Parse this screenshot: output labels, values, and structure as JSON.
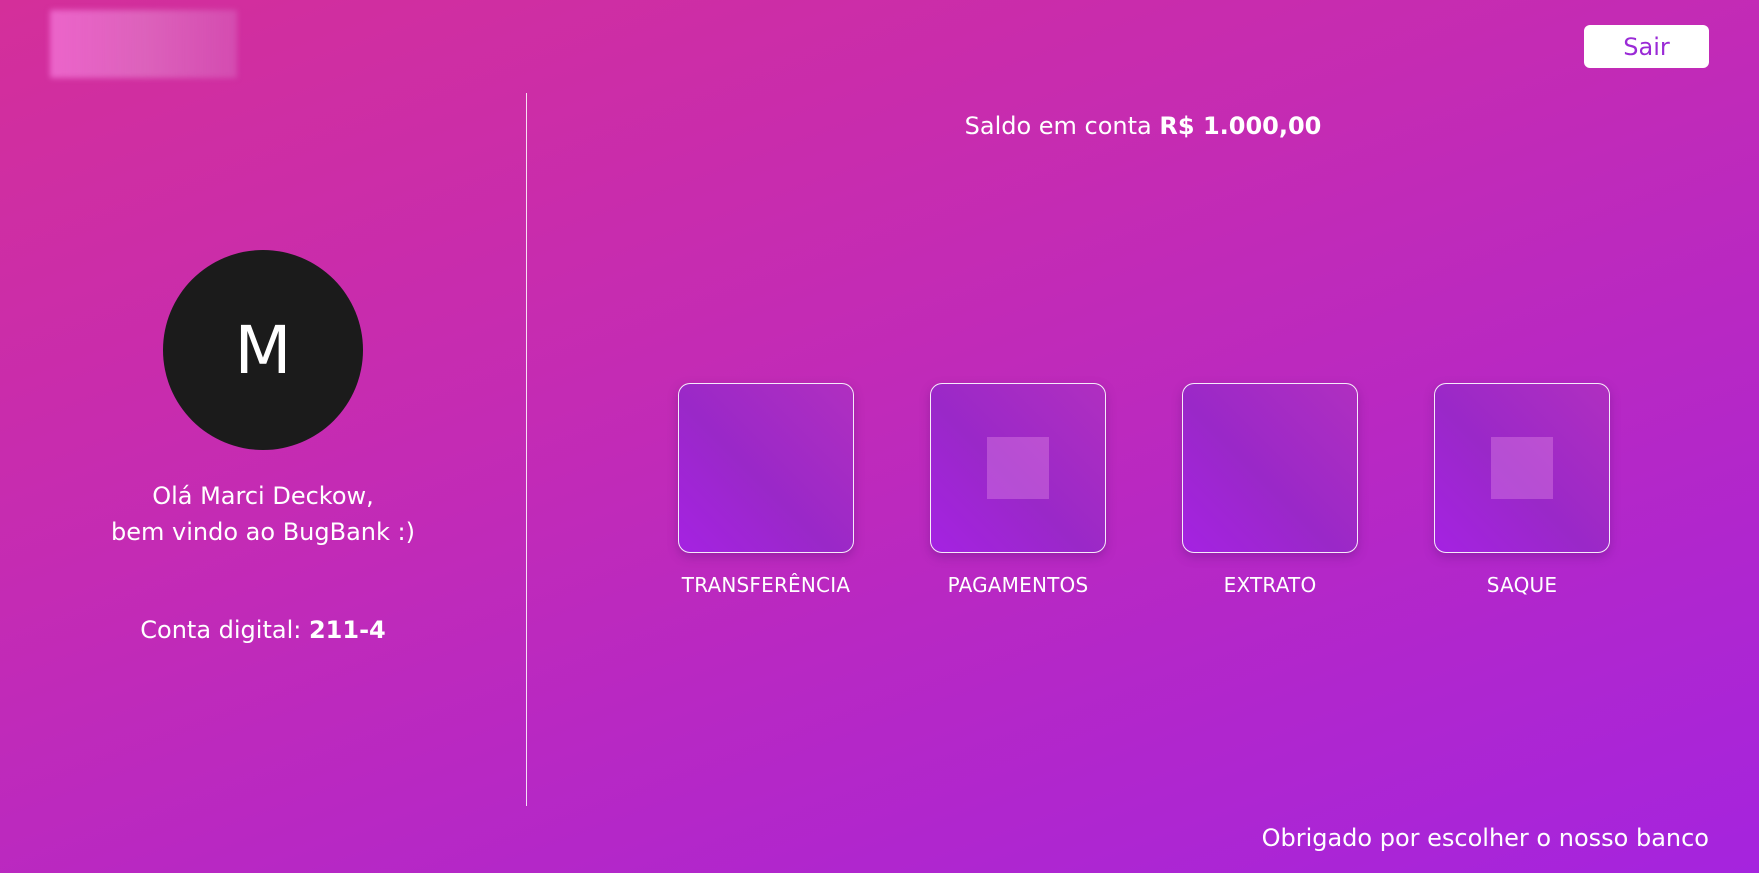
{
  "header": {
    "logout_label": "Sair"
  },
  "user": {
    "avatar_initial": "M",
    "greeting_line1": "Olá Marci Deckow,",
    "greeting_line2": "bem vindo ao BugBank :)",
    "account_label": "Conta digital:",
    "account_number": "211-4"
  },
  "balance": {
    "label": "Saldo em conta",
    "value": "R$ 1.000,00"
  },
  "actions": [
    {
      "label": "TRANSFERÊNCIA",
      "icon": "transfer-icon"
    },
    {
      "label": "PAGAMENTOS",
      "icon": "payments-icon"
    },
    {
      "label": "EXTRATO",
      "icon": "statement-icon"
    },
    {
      "label": "SAQUE",
      "icon": "withdraw-icon"
    }
  ],
  "footer": {
    "text": "Obrigado por escolher o nosso banco"
  },
  "colors": {
    "gradient_start": "#d42f9a",
    "gradient_end": "#a524de",
    "avatar_bg": "#1b1b1b",
    "logout_text": "#9a2ad6"
  }
}
